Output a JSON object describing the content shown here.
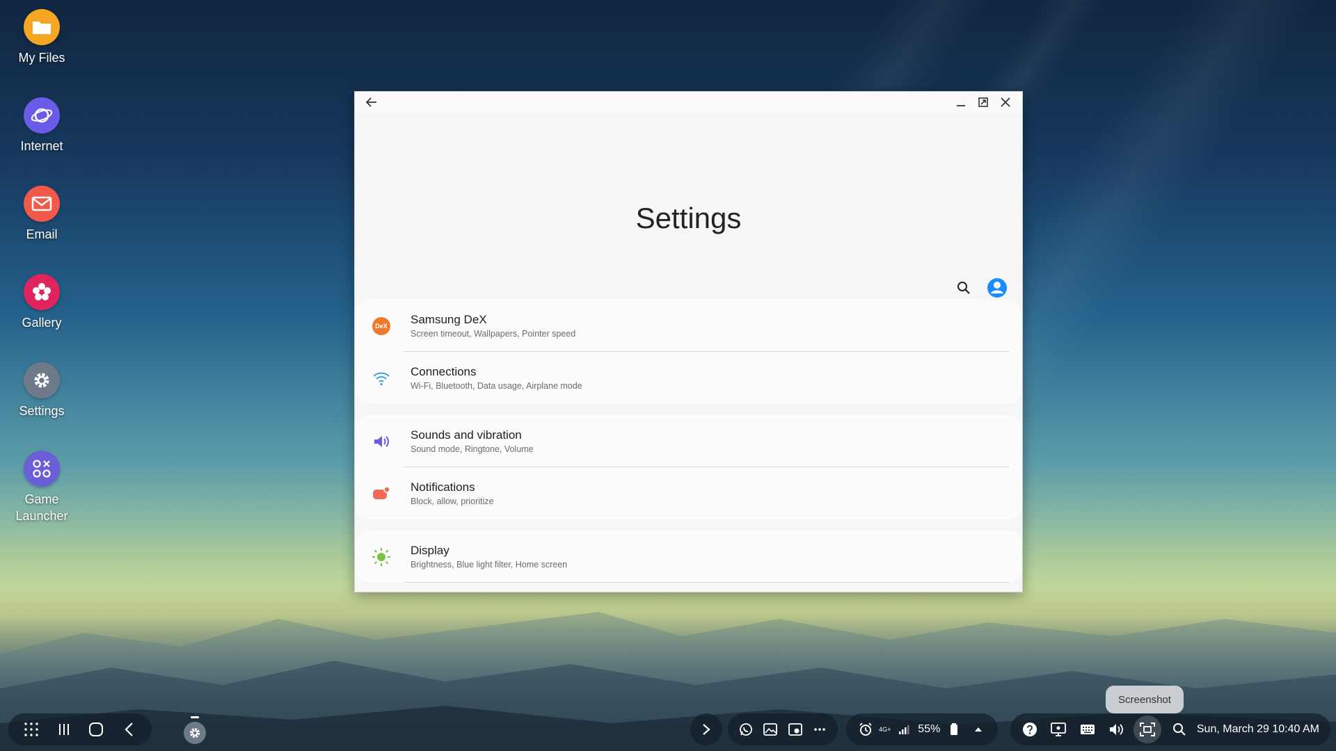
{
  "desktop": {
    "icons": [
      {
        "name": "my-files",
        "label": "My Files",
        "icon": "folder-icon",
        "color": "#f5a623"
      },
      {
        "name": "internet",
        "label": "Internet",
        "icon": "planet-icon",
        "color": "#6a5ce8"
      },
      {
        "name": "email",
        "label": "Email",
        "icon": "envelope-icon",
        "color": "#f2594b"
      },
      {
        "name": "gallery",
        "label": "Gallery",
        "icon": "flower-icon",
        "color": "#e0245e"
      },
      {
        "name": "settings",
        "label": "Settings",
        "icon": "gear-icon",
        "color": "#6e7a8a"
      },
      {
        "name": "game-launcher",
        "label": "Game Launcher",
        "label_line1": "Game",
        "label_line2": "Launcher",
        "icon": "game-icon",
        "color": "#6b5fd8"
      }
    ]
  },
  "window": {
    "title": "Settings",
    "groups": [
      [
        {
          "title": "Samsung DeX",
          "subtitle": "Screen timeout, Wallpapers, Pointer speed",
          "icon": "dex-icon",
          "color": "#f07a2c",
          "badge": "DeX"
        },
        {
          "title": "Connections",
          "subtitle": "Wi-Fi, Bluetooth, Data usage, Airplane mode",
          "icon": "wifi-icon",
          "color": "#3aa0e0"
        }
      ],
      [
        {
          "title": "Sounds and vibration",
          "subtitle": "Sound mode, Ringtone, Volume",
          "icon": "speaker-icon",
          "color": "#6a5ce8"
        },
        {
          "title": "Notifications",
          "subtitle": "Block, allow, prioritize",
          "icon": "notification-icon",
          "color": "#f06a5a"
        }
      ],
      [
        {
          "title": "Display",
          "subtitle": "Brightness, Blue light filter, Home screen",
          "icon": "sun-icon",
          "color": "#7cc242"
        }
      ]
    ]
  },
  "taskbar": {
    "battery": "55%",
    "network": "4G+",
    "datetime": "Sun, March 29 10:40 AM",
    "tooltip": "Screenshot",
    "accent": "#1a8cff"
  }
}
